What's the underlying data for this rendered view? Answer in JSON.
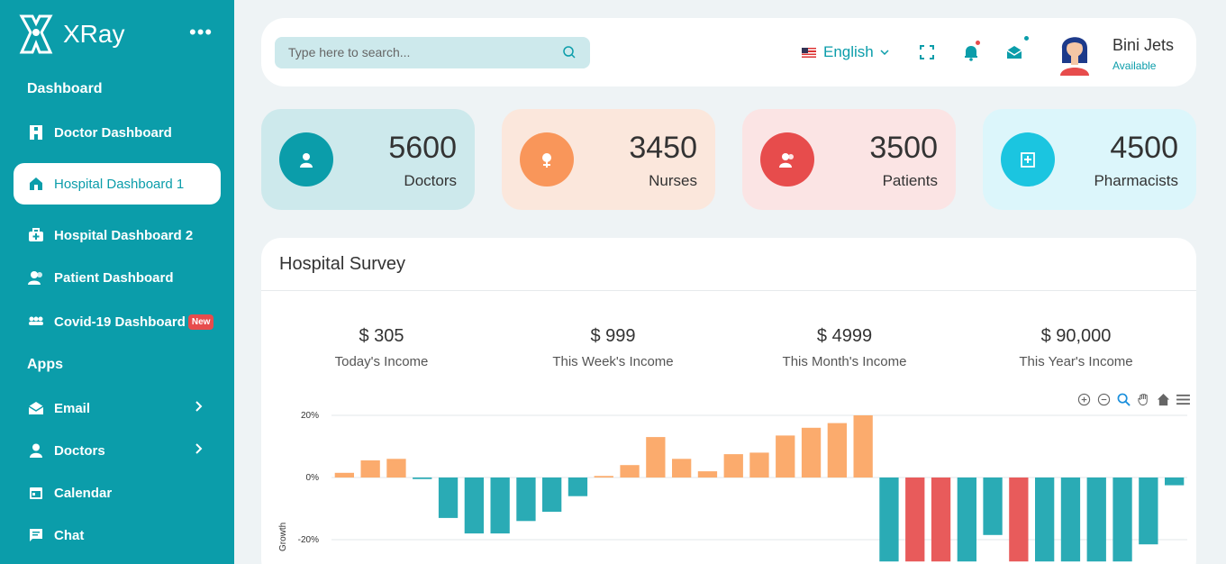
{
  "brand": {
    "name": "XRay",
    "more_icon": "more-dots-icon"
  },
  "sidebar": {
    "section_dashboard": "Dashboard",
    "section_apps": "Apps",
    "items": [
      {
        "label": "Doctor Dashboard",
        "icon": "doctor-icon"
      },
      {
        "label": "Hospital Dashboard 1",
        "icon": "hospital-icon",
        "active": true
      },
      {
        "label": "Hospital Dashboard 2",
        "icon": "medical-kit-icon"
      },
      {
        "label": "Patient Dashboard",
        "icon": "patients-icon"
      },
      {
        "label": "Covid-19 Dashboard",
        "icon": "covid-icon",
        "badge": "New"
      },
      {
        "label": "Email",
        "icon": "envelope-icon"
      },
      {
        "label": "Doctors",
        "icon": "user-icon"
      },
      {
        "label": "Calendar",
        "icon": "calendar-icon"
      },
      {
        "label": "Chat",
        "icon": "chat-icon"
      }
    ]
  },
  "header": {
    "search_placeholder": "Type here to search...",
    "language": "English",
    "user_name": "Bini Jets",
    "user_status": "Available"
  },
  "stats": [
    {
      "value": "5600",
      "label": "Doctors",
      "color": "#0b9daa"
    },
    {
      "value": "3450",
      "label": "Nurses",
      "color": "#f9965a"
    },
    {
      "value": "3500",
      "label": "Patients",
      "color": "#e74c4c"
    },
    {
      "value": "4500",
      "label": "Pharmacists",
      "color": "#1bc5e0"
    }
  ],
  "survey": {
    "title": "Hospital Survey",
    "incomes": [
      {
        "amount": "$ 305",
        "caption": "Today's Income"
      },
      {
        "amount": "$ 999",
        "caption": "This Week's Income"
      },
      {
        "amount": "$ 4999",
        "caption": "This Month's Income"
      },
      {
        "amount": "$ 90,000",
        "caption": "This Year's Income"
      }
    ]
  },
  "chart_data": {
    "type": "bar",
    "ylabel": "Growth",
    "yticks": [
      "20%",
      "0%",
      "-20%"
    ],
    "ylim": [
      -28,
      22
    ],
    "grid": true,
    "values": [
      1.5,
      5.5,
      6,
      -0.5,
      -13,
      -18,
      -18,
      -14,
      -11,
      -6,
      0.5,
      4,
      13,
      6,
      2,
      7.5,
      8,
      13.5,
      16,
      17.5,
      20,
      -27,
      -27,
      -27,
      -27,
      -18.5,
      -27,
      -27,
      -27,
      -27,
      -27,
      -21.5,
      -2.5
    ],
    "colors": {
      "positive": "#fbab6d",
      "negative": "#2aabb5",
      "strong_negative": "#e85b5b"
    },
    "strong_negative_indices": [
      22,
      23,
      26
    ]
  }
}
